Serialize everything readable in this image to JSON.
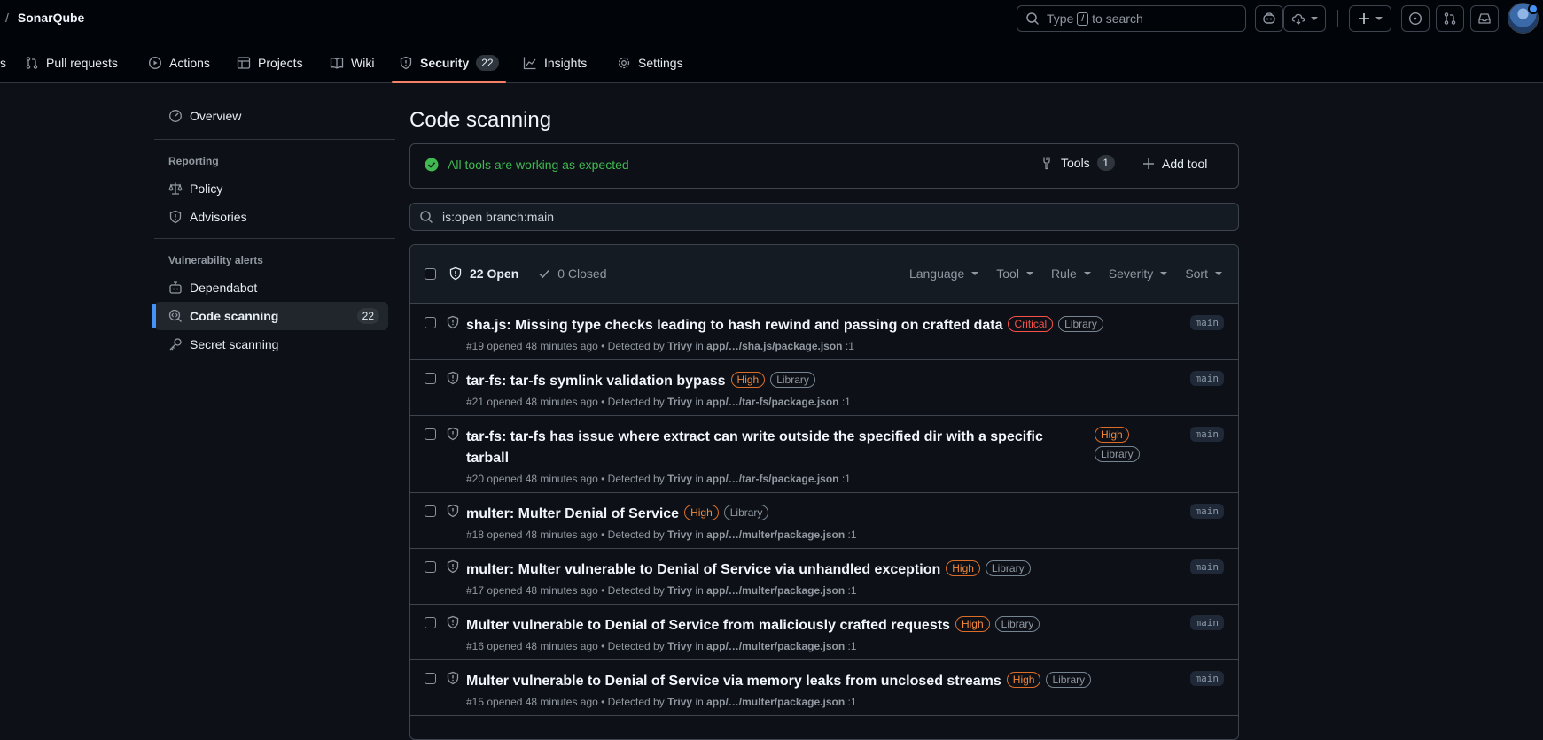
{
  "header": {
    "repo_name": "SonarQube",
    "search_placeholder_pre": "Type",
    "search_key": "/",
    "search_placeholder_post": "to search",
    "icons": [
      "copilot-icon",
      "codespaces-icon",
      "plus-icon",
      "issues-icon",
      "pull-requests-icon",
      "inbox-icon"
    ]
  },
  "tabs": [
    {
      "label": "s"
    },
    {
      "label": "Pull requests"
    },
    {
      "label": "Actions"
    },
    {
      "label": "Projects"
    },
    {
      "label": "Wiki"
    },
    {
      "label": "Security",
      "count": "22",
      "active": true
    },
    {
      "label": "Insights"
    },
    {
      "label": "Settings"
    }
  ],
  "sidebar": {
    "overview": "Overview",
    "reporting_heading": "Reporting",
    "policy": "Policy",
    "advisories": "Advisories",
    "vuln_heading": "Vulnerability alerts",
    "dependabot": "Dependabot",
    "code_scanning": "Code scanning",
    "code_scanning_count": "22",
    "secret_scanning": "Secret scanning"
  },
  "main": {
    "title": "Code scanning",
    "status_message": "All tools are working as expected",
    "tools_label": "Tools",
    "tools_count": "1",
    "add_tool_label": "Add tool",
    "filter_value": "is:open branch:main",
    "open_label": "22 Open",
    "closed_label": "0 Closed",
    "filters": {
      "language": "Language",
      "tool": "Tool",
      "rule": "Rule",
      "severity": "Severity",
      "sort": "Sort"
    }
  },
  "alerts": [
    {
      "title": "sha.js: Missing type checks leading to hash rewind and passing on crafted data",
      "severity": "Critical",
      "tag": "Library",
      "number": "#19",
      "opened": "opened 48 minutes ago • Detected by",
      "tool": "Trivy",
      "in": "in",
      "path": "app/…/sha.js/package.json",
      "line": ":1",
      "branch": "main"
    },
    {
      "title": "tar-fs: tar-fs symlink validation bypass",
      "severity": "High",
      "tag": "Library",
      "number": "#21",
      "opened": "opened 48 minutes ago • Detected by",
      "tool": "Trivy",
      "in": "in",
      "path": "app/…/tar-fs/package.json",
      "line": ":1",
      "branch": "main"
    },
    {
      "title": "tar-fs: tar-fs has issue where extract can write outside the specified dir with a specific tarball",
      "severity": "High",
      "tag": "Library",
      "number": "#20",
      "opened": "opened 48 minutes ago • Detected by",
      "tool": "Trivy",
      "in": "in",
      "path": "app/…/tar-fs/package.json",
      "line": ":1",
      "branch": "main"
    },
    {
      "title": "multer: Multer Denial of Service",
      "severity": "High",
      "tag": "Library",
      "number": "#18",
      "opened": "opened 48 minutes ago • Detected by",
      "tool": "Trivy",
      "in": "in",
      "path": "app/…/multer/package.json",
      "line": ":1",
      "branch": "main"
    },
    {
      "title": "multer: Multer vulnerable to Denial of Service via unhandled exception",
      "severity": "High",
      "tag": "Library",
      "number": "#17",
      "opened": "opened 48 minutes ago • Detected by",
      "tool": "Trivy",
      "in": "in",
      "path": "app/…/multer/package.json",
      "line": ":1",
      "branch": "main"
    },
    {
      "title": "Multer vulnerable to Denial of Service from maliciously crafted requests",
      "severity": "High",
      "tag": "Library",
      "number": "#16",
      "opened": "opened 48 minutes ago • Detected by",
      "tool": "Trivy",
      "in": "in",
      "path": "app/…/multer/package.json",
      "line": ":1",
      "branch": "main"
    },
    {
      "title": "Multer vulnerable to Denial of Service via memory leaks from unclosed streams",
      "severity": "High",
      "tag": "Library",
      "number": "#15",
      "opened": "opened 48 minutes ago • Detected by",
      "tool": "Trivy",
      "in": "in",
      "path": "app/…/multer/package.json",
      "line": ":1",
      "branch": "main"
    }
  ],
  "colors": {
    "background": "#0d1117",
    "header_bg": "#010409",
    "accent_blue": "#4493f8",
    "active_tab_underline": "#f78166",
    "success_green": "#3fb950",
    "critical": "#f85149",
    "high": "#f0883e"
  }
}
